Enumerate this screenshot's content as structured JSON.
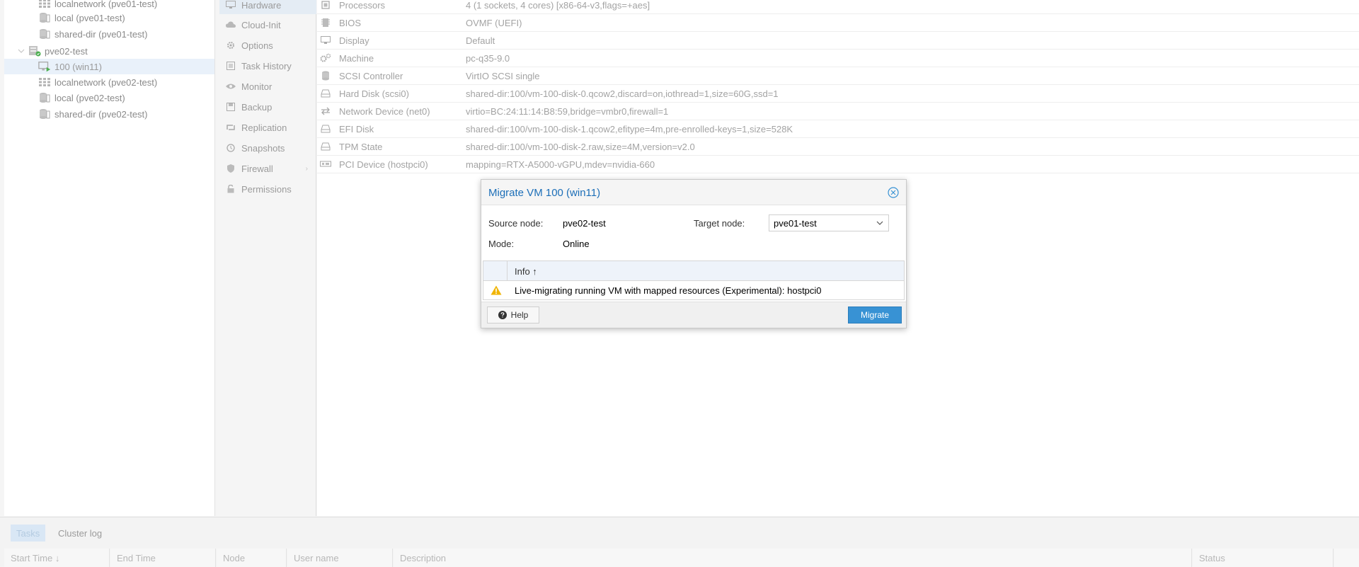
{
  "tree": {
    "items": [
      {
        "label": "localnetwork (pve01-test)",
        "icon": "network-grid-icon"
      },
      {
        "label": "local (pve01-test)",
        "icon": "storage-icon"
      },
      {
        "label": "shared-dir (pve01-test)",
        "icon": "storage-icon"
      },
      {
        "label": "pve02-test",
        "icon": "server-icon"
      },
      {
        "label": "100 (win11)",
        "icon": "vm-running-icon"
      },
      {
        "label": "localnetwork (pve02-test)",
        "icon": "network-grid-icon"
      },
      {
        "label": "local (pve02-test)",
        "icon": "storage-icon"
      },
      {
        "label": "shared-dir (pve02-test)",
        "icon": "storage-icon"
      }
    ]
  },
  "nav": {
    "items": [
      {
        "label": "Hardware",
        "icon": "monitor-icon"
      },
      {
        "label": "Cloud-Init",
        "icon": "cloud-icon"
      },
      {
        "label": "Options",
        "icon": "gear-icon"
      },
      {
        "label": "Task History",
        "icon": "list-icon"
      },
      {
        "label": "Monitor",
        "icon": "eye-icon"
      },
      {
        "label": "Backup",
        "icon": "floppy-icon"
      },
      {
        "label": "Replication",
        "icon": "retweet-icon"
      },
      {
        "label": "Snapshots",
        "icon": "history-icon"
      },
      {
        "label": "Firewall",
        "icon": "shield-icon"
      },
      {
        "label": "Permissions",
        "icon": "unlock-icon"
      }
    ]
  },
  "hardware": {
    "rows": [
      {
        "name": "Processors",
        "value": "4 (1 sockets, 4 cores) [x86-64-v3,flags=+aes]",
        "icon": "cpu-icon"
      },
      {
        "name": "BIOS",
        "value": "OVMF (UEFI)",
        "icon": "microchip-icon"
      },
      {
        "name": "Display",
        "value": "Default",
        "icon": "desktop-icon"
      },
      {
        "name": "Machine",
        "value": "pc-q35-9.0",
        "icon": "cogs-icon"
      },
      {
        "name": "SCSI Controller",
        "value": "VirtIO SCSI single",
        "icon": "database-icon"
      },
      {
        "name": "Hard Disk (scsi0)",
        "value": "shared-dir:100/vm-100-disk-0.qcow2,discard=on,iothread=1,size=60G,ssd=1",
        "icon": "hdd-icon"
      },
      {
        "name": "Network Device (net0)",
        "value": "virtio=BC:24:11:14:B8:59,bridge=vmbr0,firewall=1",
        "icon": "exchange-icon"
      },
      {
        "name": "EFI Disk",
        "value": "shared-dir:100/vm-100-disk-1.qcow2,efitype=4m,pre-enrolled-keys=1,size=528K",
        "icon": "hdd-icon"
      },
      {
        "name": "TPM State",
        "value": "shared-dir:100/vm-100-disk-2.raw,size=4M,version=v2.0",
        "icon": "hdd-icon"
      },
      {
        "name": "PCI Device (hostpci0)",
        "value": "mapping=RTX-A5000-vGPU,mdev=nvidia-660",
        "icon": "pci-card-icon"
      }
    ]
  },
  "bottom": {
    "tabs": [
      "Tasks",
      "Cluster log"
    ],
    "columns": [
      "Start Time ↓",
      "End Time",
      "Node",
      "User name",
      "Description",
      "Status"
    ]
  },
  "dialog": {
    "title": "Migrate VM 100 (win11)",
    "source_label": "Source node:",
    "source_value": "pve02-test",
    "target_label": "Target node:",
    "target_value": "pve01-test",
    "mode_label": "Mode:",
    "mode_value": "Online",
    "info_header": "Info ↑",
    "info_message": "Live-migrating running VM with mapped resources (Experimental): hostpci0",
    "help_label": "Help",
    "migrate_label": "Migrate"
  },
  "colors": {
    "accent": "#3892d4",
    "title_blue": "#1d6fb8",
    "warning": "#f0b400",
    "running_green": "#4caf50"
  }
}
